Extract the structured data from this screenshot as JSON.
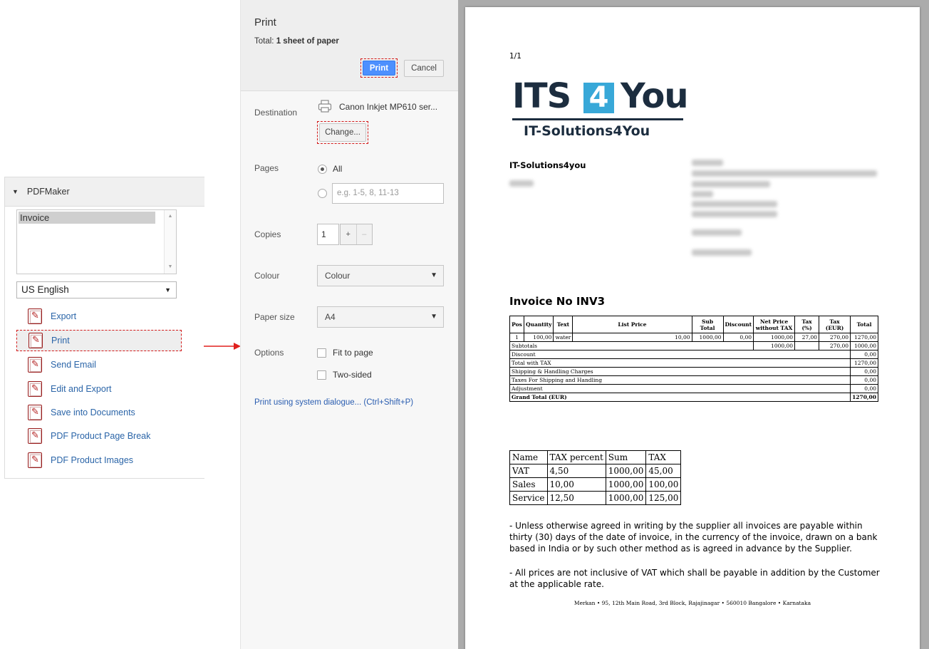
{
  "pdfmaker": {
    "title": "PDFMaker",
    "templates": [
      "Invoice"
    ],
    "language": "US English",
    "actions": [
      {
        "label": "Export"
      },
      {
        "label": "Print"
      },
      {
        "label": "Send Email"
      },
      {
        "label": "Edit and Export"
      },
      {
        "label": "Save into Documents"
      },
      {
        "label": "PDF Product Page Break"
      },
      {
        "label": "PDF Product Images"
      }
    ]
  },
  "print_dialog": {
    "title": "Print",
    "total_prefix": "Total:",
    "total_value": "1 sheet of paper",
    "print_button": "Print",
    "cancel_button": "Cancel",
    "destination_label": "Destination",
    "destination_value": "Canon Inkjet MP610 ser...",
    "change_button": "Change...",
    "pages_label": "Pages",
    "pages_all": "All",
    "pages_placeholder": "e.g. 1-5, 8, 11-13",
    "copies_label": "Copies",
    "copies_value": "1",
    "copies_plus": "+",
    "copies_minus": "–",
    "colour_label": "Colour",
    "colour_value": "Colour",
    "paper_label": "Paper size",
    "paper_value": "A4",
    "options_label": "Options",
    "option_fit": "Fit to page",
    "option_two_sided": "Two-sided",
    "system_dialog_link": "Print using system dialogue... (Ctrl+Shift+P)"
  },
  "preview": {
    "page_number": "1/1",
    "logo": {
      "its": "ITS",
      "four": "4",
      "you": "You",
      "subtitle": "IT-Solutions4You"
    },
    "company": "IT-Solutions4you",
    "invoice_title": "Invoice No INV3",
    "items_header": [
      "Pos",
      "Quantity",
      "Text",
      "List Price",
      "Sub Total",
      "Discount",
      "Net Price without TAX",
      "Tax (%)",
      "Tax (EUR)",
      "Total"
    ],
    "items_row": [
      "1",
      "100,00",
      "water",
      "10,00",
      "1000,00",
      "0,00",
      "1000,00",
      "27,00",
      "270,00",
      "1270,00"
    ],
    "summary": [
      {
        "label": "Subtotals",
        "net": "1000,00",
        "tax": "270,00",
        "total": "1000,00"
      },
      {
        "label": "Discount",
        "total": "0,00"
      },
      {
        "label": "Total with TAX",
        "total": "1270,00"
      },
      {
        "label": "Shipping & Handling Charges",
        "total": "0,00"
      },
      {
        "label": "Taxes For Shipping and Handling",
        "total": "0,00"
      },
      {
        "label": "Adjustment",
        "total": "0,00"
      },
      {
        "label": "Grand Total (EUR)",
        "total": "1270,00"
      }
    ],
    "tax_table": [
      [
        "Name",
        "TAX percent",
        "Sum",
        "TAX"
      ],
      [
        "VAT",
        "4,50",
        "1000,00",
        "45,00"
      ],
      [
        "Sales",
        "10,00",
        "1000,00",
        "100,00"
      ],
      [
        "Service",
        "12,50",
        "1000,00",
        "125,00"
      ]
    ],
    "terms_1": "- Unless otherwise agreed in writing by the supplier all invoices are payable within thirty (30) days of the date of invoice, in the currency of the invoice, drawn on a bank based in India or by such other method as is agreed in advance by the Supplier.",
    "terms_2": "- All prices are not inclusive of VAT which shall be payable in addition by the Customer at the applicable rate.",
    "footer": "Merkan • 95, 12th Main Road, 3rd Block, Rajajinagar • 560010 Bangalore • Karnataka"
  }
}
